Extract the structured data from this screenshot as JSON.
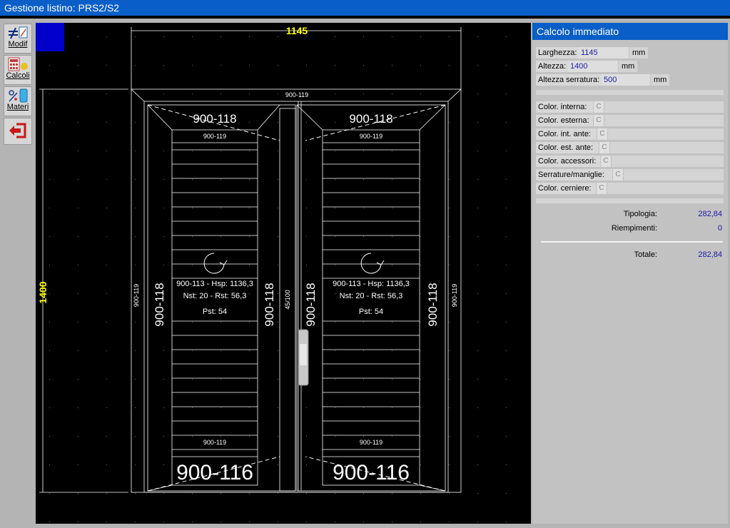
{
  "window": {
    "title": "Gestione listino: PRS2/S2"
  },
  "toolbar": {
    "buttons": [
      {
        "label": "Modif",
        "icon": "edit-icon"
      },
      {
        "label": "Calcoli",
        "icon": "calculator-icon"
      },
      {
        "label": "Materi",
        "icon": "materials-icon"
      },
      {
        "label": "",
        "icon": "exit-icon"
      }
    ]
  },
  "drawing": {
    "width_dim": "1145",
    "height_dim": "1400",
    "top_profile": "900-119",
    "left_profile_small": "900-119",
    "right_profile_small": "900-119",
    "center_small": "45/100",
    "leaf_left": {
      "top": "900-118",
      "top_small": "900-119",
      "side_left": "900-118",
      "side_right": "900-118",
      "bottom_small": "900-119",
      "bottom": "900-116",
      "line1": "900-113 - Hsp: 1136,3",
      "line2": "Nst: 20 - Rst: 56,3",
      "line3": "Pst: 54"
    },
    "leaf_right": {
      "top": "900-118",
      "top_small": "900-119",
      "side_left": "900-118",
      "side_right": "900-118",
      "bottom_small": "900-119",
      "bottom": "900-116",
      "line1": "900-113 - Hsp: 1136,3",
      "line2": "Nst: 20 - Rst: 56,3",
      "line3": "Pst: 54"
    }
  },
  "panel": {
    "title": "Calcolo immediato",
    "dims": [
      {
        "label": "Larghezza:",
        "value": "1145",
        "unit": "mm"
      },
      {
        "label": "Altezza:",
        "value": "1400",
        "unit": "mm"
      },
      {
        "label": "Altezza serratura:",
        "value": "500",
        "unit": "mm"
      }
    ],
    "colors": [
      {
        "label": "Color. interna:",
        "code": "C"
      },
      {
        "label": "Color. esterna:",
        "code": "C"
      },
      {
        "label": "Color. int. ante:",
        "code": "C"
      },
      {
        "label": "Color. est. ante:",
        "code": "C"
      },
      {
        "label": "Color. accessori:",
        "code": "C"
      },
      {
        "label": "Serrature/maniglie:",
        "code": "C"
      },
      {
        "label": "Color. cerniere:",
        "code": "C"
      }
    ],
    "totals": [
      {
        "label": "Tipologia:",
        "value": "282,84"
      },
      {
        "label": "Riempimenti:",
        "value": "0"
      }
    ],
    "grand_total": {
      "label": "Totale:",
      "value": "282,84"
    }
  },
  "colors": {
    "accent": "#0a5ec8",
    "canvas_bg": "#000000",
    "canvas_border": "#0000c8",
    "dim_text": "#ffff00"
  }
}
